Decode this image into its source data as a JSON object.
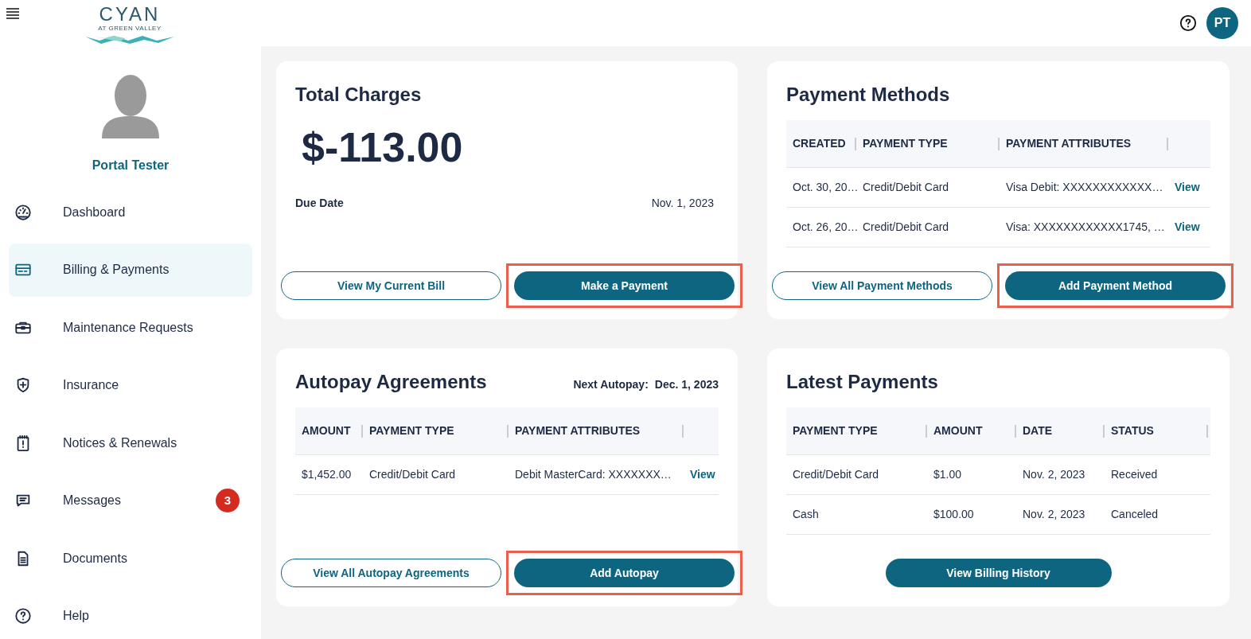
{
  "header": {
    "logo": {
      "name": "CYAN",
      "tagline": "AT GREEN VALLEY"
    },
    "avatar": "PT"
  },
  "profile": {
    "name": "Portal Tester"
  },
  "sidebar": {
    "items": [
      {
        "label": "Dashboard",
        "kind": "gauge",
        "selected": false
      },
      {
        "label": "Billing & Payments",
        "kind": "card",
        "selected": true
      },
      {
        "label": "Maintenance Requests",
        "kind": "toolbox",
        "selected": false
      },
      {
        "label": "Insurance",
        "kind": "shield",
        "selected": false
      },
      {
        "label": "Notices & Renewals",
        "kind": "notice",
        "selected": false
      },
      {
        "label": "Messages",
        "kind": "chat",
        "selected": false,
        "badge": "3"
      },
      {
        "label": "Documents",
        "kind": "document",
        "selected": false
      },
      {
        "label": "Help",
        "kind": "help",
        "selected": false
      }
    ]
  },
  "total_charges": {
    "title": "Total Charges",
    "amount": "$-113.00",
    "due_label": "Due Date",
    "due_value": "Nov. 1, 2023",
    "buttons": [
      {
        "label": "View My Current Bill",
        "kind": "outline",
        "highlighted": false
      },
      {
        "label": "Make a Payment",
        "kind": "filled",
        "highlighted": true
      }
    ]
  },
  "payment_methods": {
    "title": "Payment Methods",
    "table": {
      "columns": [
        "CREATED",
        "PAYMENT TYPE",
        "PAYMENT ATTRIBUTES"
      ],
      "rows": [
        {
          "cells": [
            "Oct. 30, 20…",
            "Credit/Debit Card",
            "Visa Debit: XXXXXXXXXXXX…"
          ],
          "link": "View"
        },
        {
          "cells": [
            "Oct. 26, 20…",
            "Credit/Debit Card",
            "Visa: XXXXXXXXXXXX1745, …"
          ],
          "link": "View"
        }
      ]
    },
    "buttons": [
      {
        "label": "View All Payment Methods",
        "kind": "outline",
        "highlighted": false
      },
      {
        "label": "Add Payment Method",
        "kind": "filled",
        "highlighted": true
      }
    ]
  },
  "autopay": {
    "title": "Autopay Agreements",
    "next_label": "Next Autopay:",
    "next_value": "Dec. 1, 2023",
    "table": {
      "columns": [
        "AMOUNT",
        "PAYMENT TYPE",
        "PAYMENT ATTRIBUTES"
      ],
      "rows": [
        {
          "cells": [
            "$1,452.00",
            "Credit/Debit Card",
            "Debit MasterCard: XXXXXXX…"
          ],
          "link": "View"
        }
      ]
    },
    "buttons": [
      {
        "label": "View All Autopay Agreements",
        "kind": "outline",
        "highlighted": false
      },
      {
        "label": "Add Autopay",
        "kind": "filled",
        "highlighted": true
      }
    ]
  },
  "latest_payments": {
    "title": "Latest Payments",
    "table": {
      "columns": [
        "PAYMENT TYPE",
        "AMOUNT",
        "DATE",
        "STATUS"
      ],
      "rows": [
        {
          "cells": [
            "Credit/Debit Card",
            "$1.00",
            "Nov. 2, 2023",
            "Received"
          ]
        },
        {
          "cells": [
            "Cash",
            "$100.00",
            "Nov. 2, 2023",
            "Canceled"
          ]
        }
      ]
    },
    "buttons": [
      {
        "label": "View Billing History",
        "kind": "filled",
        "highlighted": false
      }
    ]
  }
}
